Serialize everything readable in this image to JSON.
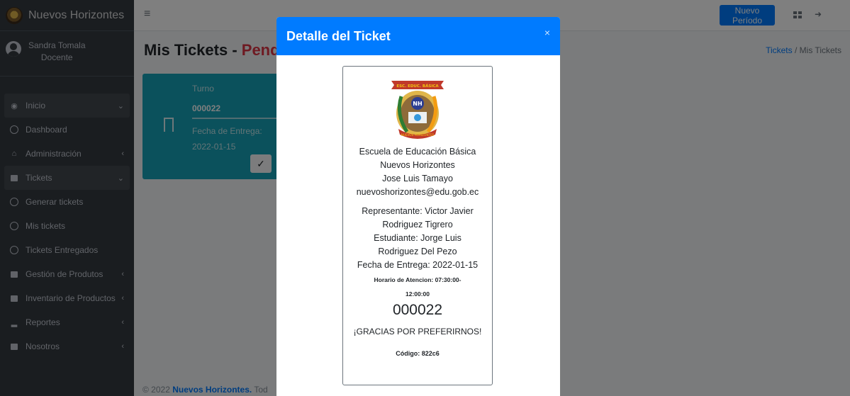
{
  "brand": {
    "name": "Nuevos Horizontes"
  },
  "user": {
    "name": "Sandra Tomala",
    "role": "Docente"
  },
  "sidebar": {
    "items": [
      {
        "label": "Inicio",
        "icon": "tachometer-icon"
      },
      {
        "label": "Dashboard",
        "icon": "circle-icon"
      },
      {
        "label": "Administración",
        "icon": "bank-icon"
      },
      {
        "label": "Tickets",
        "icon": "ticket-icon"
      },
      {
        "label": "Generar tickets",
        "icon": "circle-icon"
      },
      {
        "label": "Mis tickets",
        "icon": "circle-icon"
      },
      {
        "label": "Tickets Entregados",
        "icon": "circle-icon"
      },
      {
        "label": "Gestión de Produtos",
        "icon": "box-icon"
      },
      {
        "label": "Inventario de Productos",
        "icon": "checkbox-icon"
      },
      {
        "label": "Reportes",
        "icon": "chart-icon"
      },
      {
        "label": "Nosotros",
        "icon": "book-icon"
      }
    ]
  },
  "topbar": {
    "new_period_label": "Nuevo Período"
  },
  "page": {
    "title": "Mis Tickets - ",
    "title_status": "Pend",
    "breadcrumb_link": "Tickets",
    "breadcrumb_sep": " / ",
    "breadcrumb_current": "Mis Tickets"
  },
  "card": {
    "turno_label": "Turno",
    "turno_value": "000022",
    "fecha_label": "Fecha de Entrega:",
    "fecha_value": "2022-01-15"
  },
  "footer": {
    "prefix": "© 2022 ",
    "brand": "Nuevos Horizontes.",
    "suffix": " Tod"
  },
  "modal": {
    "title": "Detalle del Ticket",
    "close": "×",
    "ticket": {
      "logo_text_top": "ESC. EDUC. BÁSICA",
      "logo_text_mid": "NH",
      "logo_text_bottom": "NUEVOS HORIZONTES",
      "school_line1": "Escuela de Educación Básica",
      "school_line2": "Nuevos Horizontes",
      "director": "Jose Luis Tamayo",
      "email": "nuevoshorizontes@edu.gob.ec",
      "representante_1": "Representante: Victor Javier",
      "representante_2": "Rodriguez Tigrero",
      "estudiante_1": "Estudiante: Jorge Luis",
      "estudiante_2": "Rodriguez Del Pezo",
      "fecha": "Fecha de Entrega: 2022-01-15",
      "horario_1": "Horario de Atencion: 07:30:00-",
      "horario_2": "12:00:00",
      "turno": "000022",
      "gracias": "¡GRACIAS POR PREFERIRNOS!",
      "codigo": "Código: 822c6"
    }
  },
  "colors": {
    "primary": "#007bff",
    "info": "#17a2b8",
    "danger": "#dc3545",
    "sidebar": "#343a40"
  }
}
